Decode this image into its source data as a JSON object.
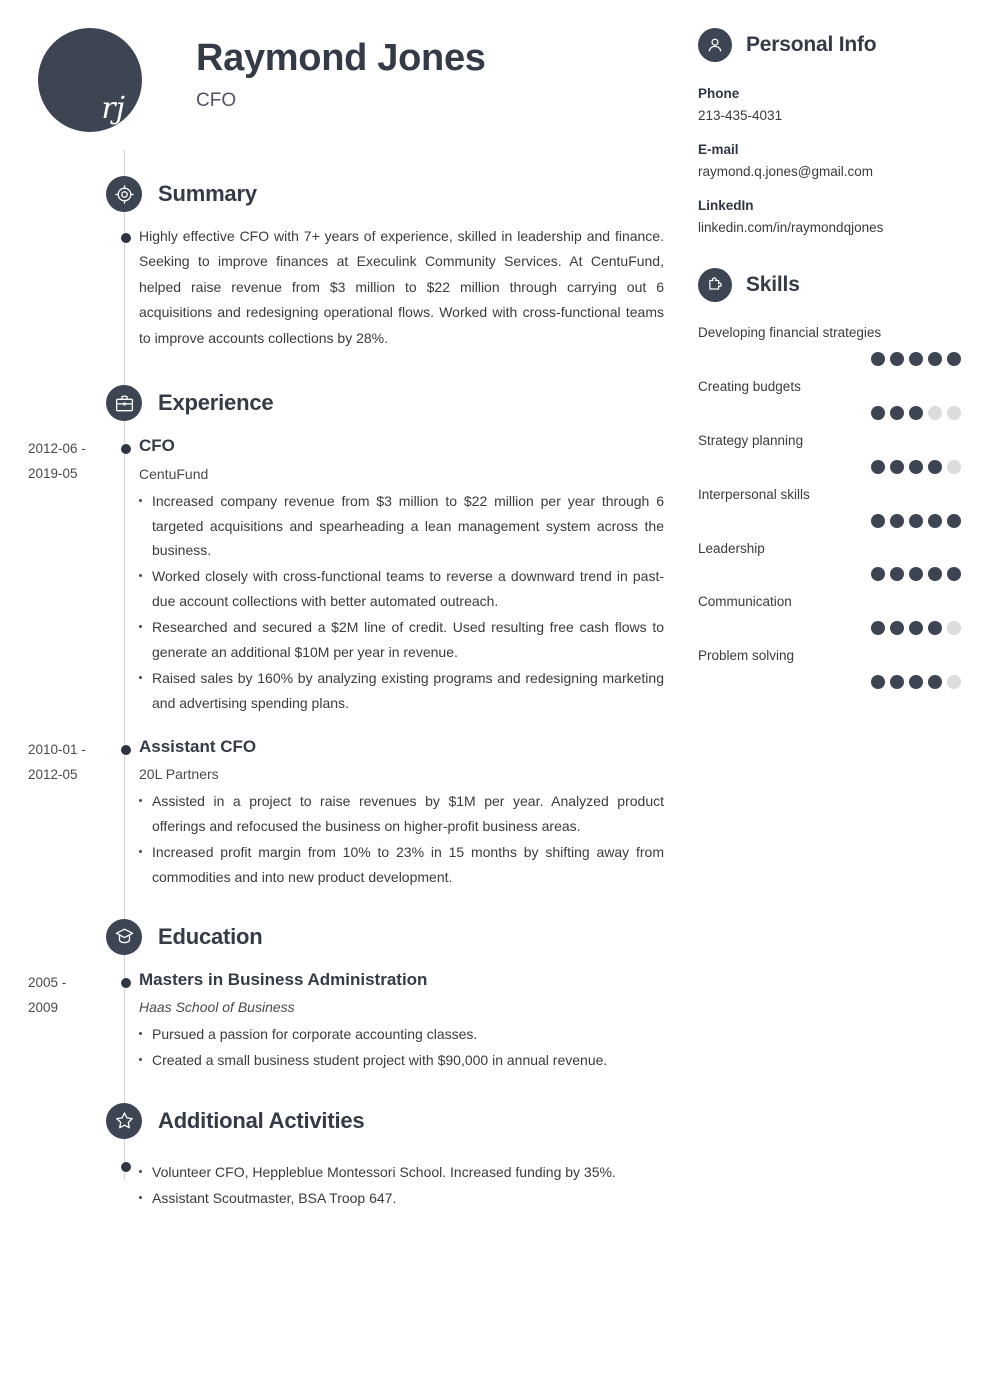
{
  "theme": {
    "dark": "#3d4452",
    "dot_empty": "#dcdcdc",
    "rail": "#d2d2d2",
    "heading": "#343b47"
  },
  "header": {
    "monogram": "rj",
    "name": "Raymond Jones",
    "job_title": "CFO"
  },
  "sections": {
    "summary": {
      "title": "Summary",
      "icon": "target-icon",
      "text": "Highly effective CFO with 7+ years of experience, skilled in leadership and finance. Seeking to improve finances at Execulink Community Services. At CentuFund, helped raise revenue from $3 million to $22 million through carrying out 6 acquisitions and redesigning operational flows. Worked with cross-functional teams to improve accounts collections by 28%."
    },
    "experience": {
      "title": "Experience",
      "icon": "briefcase-icon",
      "entries": [
        {
          "date_line1": "2012-06 -",
          "date_line2": "2019-05",
          "title": "CFO",
          "company": "CentuFund",
          "bullets": [
            "Increased company revenue from $3 million to $22 million per year through 6 targeted acquisitions and spearheading a lean management system across the business.",
            "Worked closely with cross-functional teams to reverse a downward trend in past-due account collections with better automated outreach.",
            "Researched and secured a $2M line of credit. Used resulting free cash flows to generate an additional $10M per year in revenue.",
            "Raised sales by 160% by analyzing existing programs and redesigning marketing and advertising spending plans."
          ]
        },
        {
          "date_line1": "2010-01 -",
          "date_line2": "2012-05",
          "title": "Assistant CFO",
          "company": "20L Partners",
          "bullets": [
            "Assisted in a project to raise revenues by $1M per year. Analyzed product offerings and refocused the business on higher-profit business areas.",
            "Increased profit margin from 10% to 23% in 15 months by shifting away from commodities and into new product development."
          ]
        }
      ]
    },
    "education": {
      "title": "Education",
      "icon": "graduation-cap-icon",
      "entries": [
        {
          "date_line1": "2005 -",
          "date_line2": "2009",
          "title": "Masters in Business Administration",
          "school": "Haas School of Business",
          "bullets": [
            "Pursued a passion for corporate accounting classes.",
            "Created a small business student project with $90,000 in annual revenue."
          ]
        }
      ]
    },
    "activities": {
      "title": "Additional Activities",
      "icon": "star-icon",
      "bullets": [
        "Volunteer CFO, Heppleblue Montessori School. Increased funding by 35%.",
        "Assistant Scoutmaster, BSA Troop 647."
      ]
    }
  },
  "sidebar": {
    "personal_info": {
      "title": "Personal Info",
      "icon": "user-icon",
      "items": [
        {
          "label": "Phone",
          "value": "213-435-4031"
        },
        {
          "label": "E-mail",
          "value": "raymond.q.jones@gmail.com"
        },
        {
          "label": "LinkedIn",
          "value": "linkedin.com/in/raymondqjones"
        }
      ]
    },
    "skills": {
      "title": "Skills",
      "icon": "puzzle-icon",
      "max_level": 5,
      "items": [
        {
          "name": "Developing financial strategies",
          "level": 5
        },
        {
          "name": "Creating budgets",
          "level": 3
        },
        {
          "name": "Strategy planning",
          "level": 4
        },
        {
          "name": "Interpersonal skills",
          "level": 5
        },
        {
          "name": "Leadership",
          "level": 5
        },
        {
          "name": "Communication",
          "level": 4
        },
        {
          "name": "Problem solving",
          "level": 4
        }
      ]
    }
  }
}
